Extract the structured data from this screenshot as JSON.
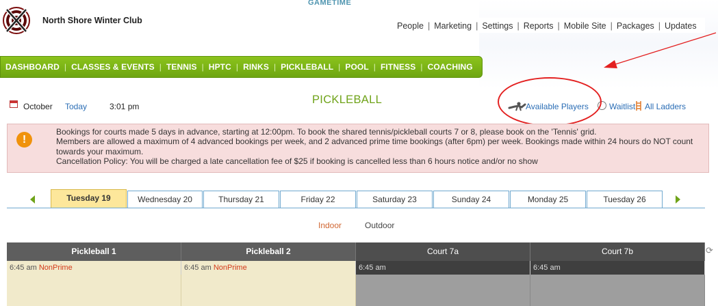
{
  "header": {
    "club_name": "North Shore Winter Club",
    "ghost_text": "GAMETIME",
    "top_nav": [
      "People",
      "Marketing",
      "Settings",
      "Reports",
      "Mobile Site",
      "Packages",
      "Updates"
    ]
  },
  "main_nav": {
    "items": [
      "DASHBOARD",
      "CLASSES & EVENTS",
      "TENNIS",
      "HPTC",
      "RINKS",
      "PICKLEBALL",
      "POOL",
      "FITNESS",
      "COACHING"
    ],
    "active": "PICKLEBALL"
  },
  "toolbar": {
    "month": "October",
    "today": "Today",
    "time": "3:01 pm",
    "page_title": "PICKLEBALL",
    "available_players": "Available Players",
    "waitlist": "Waitlist",
    "all_ladders": "All Ladders"
  },
  "notice": {
    "icon": "warning-icon",
    "lines": [
      "Bookings for courts made 5 days in advance, starting at 12:00pm. To book the shared tennis/pickleball courts 7 or 8, please book on the 'Tennis' grid.",
      "Members are allowed a maximum of 4 advanced bookings per week, and 2 advanced prime time bookings (after 6pm) per week. Bookings made within 24 hours do NOT count towards your maximum.",
      "Cancellation Policy: You will be charged a late cancellation fee of $25 if booking is cancelled less than 6 hours notice and/or no show"
    ]
  },
  "day_tabs": {
    "items": [
      "Tuesday 19",
      "Wednesday 20",
      "Thursday 21",
      "Friday 22",
      "Saturday 23",
      "Sunday 24",
      "Monday 25",
      "Tuesday 26"
    ],
    "active": "Tuesday 19"
  },
  "location_filter": {
    "indoor": "Indoor",
    "outdoor": "Outdoor",
    "active": "Indoor"
  },
  "grid": {
    "columns": [
      {
        "name": "Pickleball 1",
        "first_slot_time": "6:45 am",
        "first_slot_tag": "NonPrime"
      },
      {
        "name": "Pickleball 2",
        "first_slot_time": "6:45 am",
        "first_slot_tag": "NonPrime"
      },
      {
        "name": "Court 7a",
        "first_slot_time": "6:45 am",
        "first_slot_tag": ""
      },
      {
        "name": "Court 7b",
        "first_slot_time": "6:45 am",
        "first_slot_tag": ""
      }
    ]
  },
  "colors": {
    "brand_green": "#7ab317",
    "link_blue": "#2a6db5",
    "annotation_red": "#e32020",
    "active_tab": "#fde79b",
    "notice_bg": "#f7dddd"
  }
}
